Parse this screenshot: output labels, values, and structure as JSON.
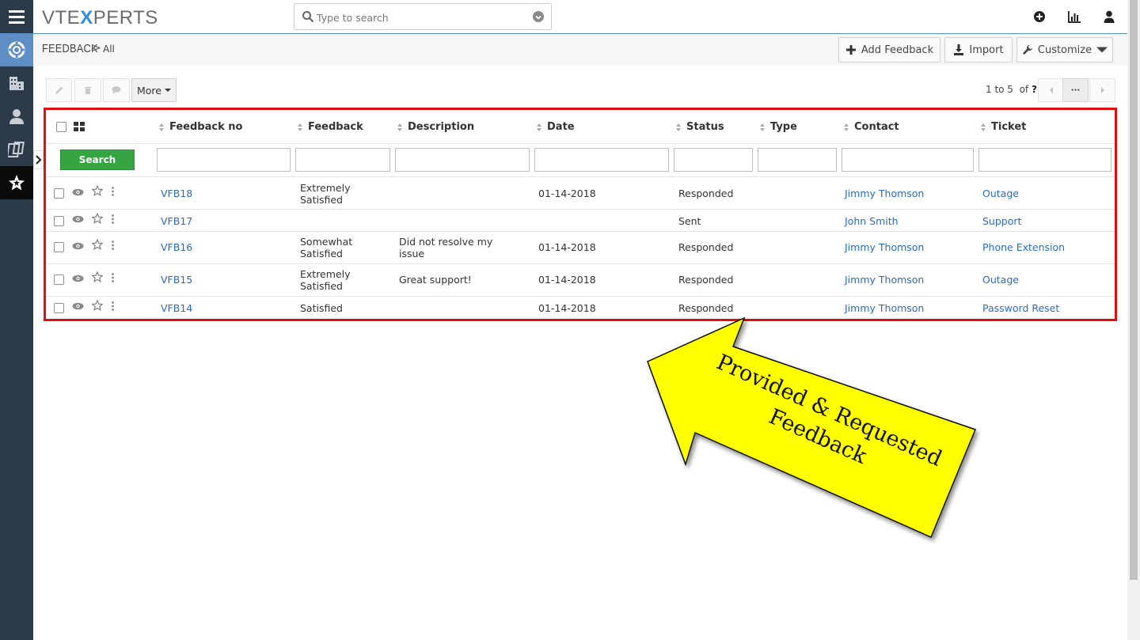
{
  "app": {
    "logo": {
      "prefix": "VTE",
      "x": "X",
      "suffix": "PERTS"
    },
    "search": {
      "placeholder": "Type to search"
    }
  },
  "breadcrumb": {
    "module": "FEEDBACK",
    "separator": ">",
    "view": "All"
  },
  "header_buttons": {
    "add": "Add Feedback",
    "import": "Import",
    "customize": "Customize"
  },
  "toolbar": {
    "more_label": "More",
    "pager_prefix": "1 to 5",
    "pager_of": "of",
    "pager_total": "?",
    "menu_label": "···"
  },
  "columns": [
    "Feedback no",
    "Feedback",
    "Description",
    "Date",
    "Status",
    "Type",
    "Contact",
    "Ticket"
  ],
  "search_button": "Search",
  "rows": [
    {
      "no": "VFB18",
      "feedback_l1": "Extremely",
      "feedback_l2": "Satisfied",
      "desc_l1": "",
      "desc_l2": "",
      "date": "01-14-2018",
      "status": "Responded",
      "type": "",
      "contact": "Jimmy Thomson",
      "ticket": "Outage"
    },
    {
      "no": "VFB17",
      "feedback_l1": "",
      "feedback_l2": "",
      "desc_l1": "",
      "desc_l2": "",
      "date": "",
      "status": "Sent",
      "type": "",
      "contact": "John Smith",
      "ticket": "Support"
    },
    {
      "no": "VFB16",
      "feedback_l1": "Somewhat",
      "feedback_l2": "Satisfied",
      "desc_l1": "Did not resolve my",
      "desc_l2": "issue",
      "date": "01-14-2018",
      "status": "Responded",
      "type": "",
      "contact": "Jimmy Thomson",
      "ticket": "Phone Extension"
    },
    {
      "no": "VFB15",
      "feedback_l1": "Extremely",
      "feedback_l2": "Satisfied",
      "desc_l1": "Great support!",
      "desc_l2": "",
      "date": "01-14-2018",
      "status": "Responded",
      "type": "",
      "contact": "Jimmy Thomson",
      "ticket": "Outage"
    },
    {
      "no": "VFB14",
      "feedback_l1": "Satisfied",
      "feedback_l2": "",
      "desc_l1": "",
      "desc_l2": "",
      "date": "01-14-2018",
      "status": "Responded",
      "type": "",
      "contact": "Jimmy Thomson",
      "ticket": "Password Reset"
    }
  ],
  "callout": {
    "line1": "Provided  & Requested",
    "line2": "Feedback"
  },
  "colors": {
    "rail": "#2c3b49",
    "link": "#2b6cb8",
    "search_button": "#35a542",
    "highlight": "#e01010",
    "arrow_fill": "#ffff00"
  }
}
